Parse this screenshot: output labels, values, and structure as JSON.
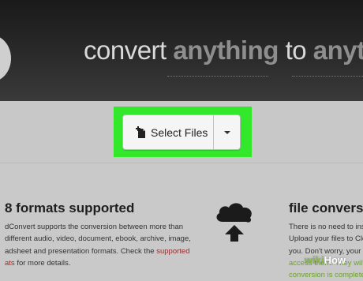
{
  "hero": {
    "headline_1": "convert",
    "headline_2": "anything",
    "headline_3": "to",
    "headline_4": "anyth"
  },
  "upload": {
    "select_label": "Select Files",
    "highlight_color": "#33e82a"
  },
  "sections": {
    "formats_title": "8 formats supported",
    "formats_lines": [
      "dConvert supports the conversion between more than",
      "different audio, video, document, ebook, archive, image,",
      "adsheet and presentation formats. Check the "
    ],
    "formats_link": "supported",
    "formats_tail_link": "ats",
    "formats_tail": " for more details.",
    "conversion_title": "file conversio",
    "conversion_lines": [
      "There is no need to inst",
      "Upload your files to Clo",
      "you. Don't worry, your fil",
      "access them. They will b",
      "conversion is complete"
    ]
  },
  "watermark": {
    "wiki": "wiki",
    "how": "How"
  }
}
